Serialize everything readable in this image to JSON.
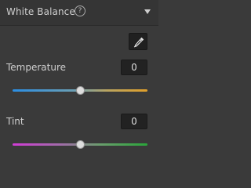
{
  "header": {
    "title": "White Balance",
    "help_icon_glyph": "?"
  },
  "sliders": [
    {
      "label": "Temperature",
      "value": "0",
      "position_fraction": 0.5
    },
    {
      "label": "Tint",
      "value": "0",
      "position_fraction": 0.5
    }
  ],
  "colors": {
    "temperature_start": "#2b8ee3",
    "temperature_end": "#e1a02a",
    "tint_start": "#d13cd6",
    "tint_end": "#2aa53a"
  },
  "icons": {
    "help": "help-icon",
    "collapse": "chevron-down-icon",
    "picker": "eyedropper-icon"
  }
}
